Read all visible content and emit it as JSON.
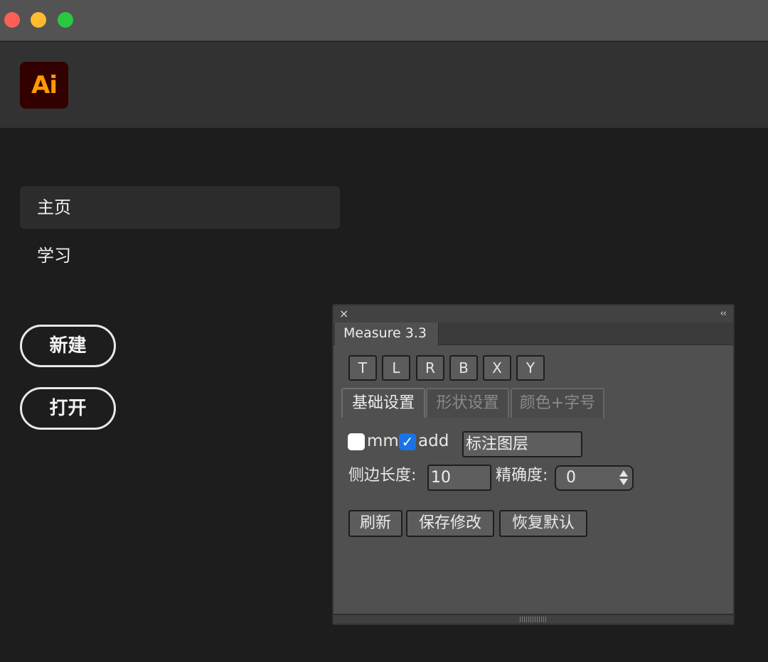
{
  "window": {
    "controls": [
      "close",
      "minimize",
      "zoom"
    ]
  },
  "header": {
    "logo_text": "Ai",
    "logo_color": "#ff9a00",
    "logo_bg": "#330000"
  },
  "sidebar": {
    "items": [
      {
        "label": "主页",
        "active": true
      },
      {
        "label": "学习",
        "active": false
      }
    ],
    "buttons": {
      "new_label": "新建",
      "open_label": "打开"
    }
  },
  "panel": {
    "close_glyph": "×",
    "collapse_glyph": "‹‹",
    "tab_title": "Measure 3.3",
    "side_buttons": [
      "T",
      "L",
      "R",
      "B",
      "X",
      "Y"
    ],
    "sub_tabs": [
      {
        "label": "基础设置",
        "active": true
      },
      {
        "label": "形状设置",
        "active": false
      },
      {
        "label": "颜色+字号",
        "active": false
      }
    ],
    "checkboxes": [
      {
        "label": "mm",
        "checked": false
      },
      {
        "label": "add",
        "checked": true
      }
    ],
    "checkmark_glyph": "✓",
    "layer_field_value": "标注图层",
    "side_length_label": "侧边长度:",
    "side_length_value": "10",
    "precision_label": "精确度:",
    "precision_value": "0",
    "actions": {
      "refresh_label": "刷新",
      "save_label": "保存修改",
      "reset_label": "恢复默认"
    }
  }
}
